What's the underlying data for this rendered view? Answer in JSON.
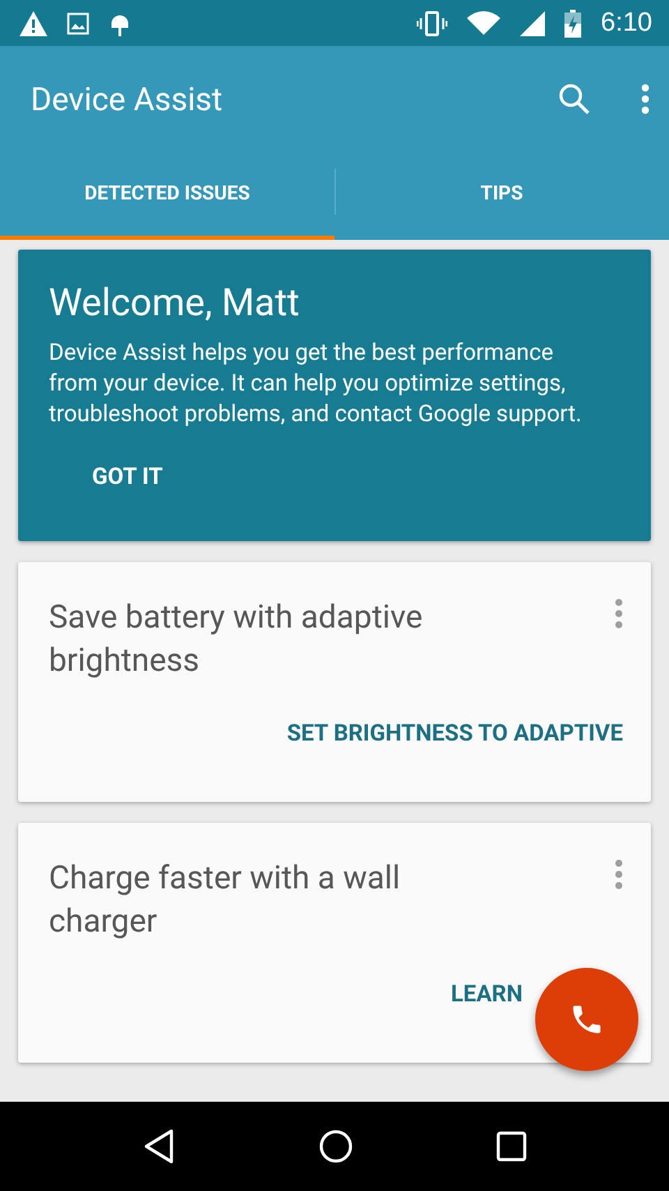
{
  "status_bar": {
    "time": "6:10"
  },
  "app_bar": {
    "title": "Device Assist"
  },
  "tabs": [
    {
      "label": "DETECTED ISSUES",
      "selected": true
    },
    {
      "label": "TIPS",
      "selected": false
    }
  ],
  "welcome_card": {
    "title": "Welcome, Matt",
    "body": "Device Assist helps you get the best performance from your device. It can help you optimize settings, troubleshoot problems, and contact Google support.",
    "action": "GOT IT"
  },
  "issues": [
    {
      "title": "Save battery with adaptive brightness",
      "action": "SET BRIGHTNESS TO ADAPTIVE"
    },
    {
      "title": "Charge faster with a wall charger",
      "action": "LEARN"
    }
  ]
}
